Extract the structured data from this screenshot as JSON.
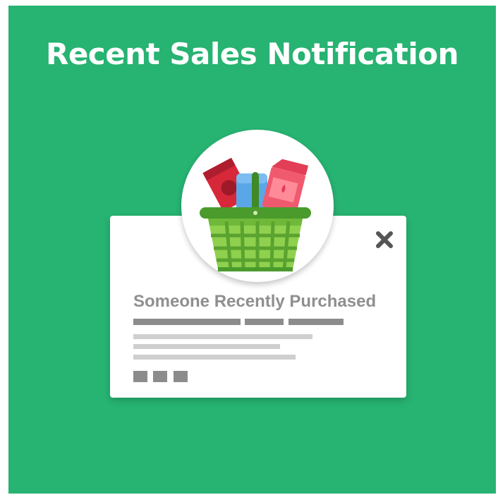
{
  "banner": {
    "title": "Recent Sales Notification"
  },
  "popup": {
    "heading": "Someone Recently Purchased",
    "close_icon": "close-icon",
    "product_icon": "shopping-basket-icon"
  },
  "colors": {
    "background": "#27b372",
    "card": "#ffffff",
    "heading_text": "#8f8f8f",
    "placeholder_dark": "#8c8c8c",
    "placeholder_light": "#cfcfcf"
  }
}
